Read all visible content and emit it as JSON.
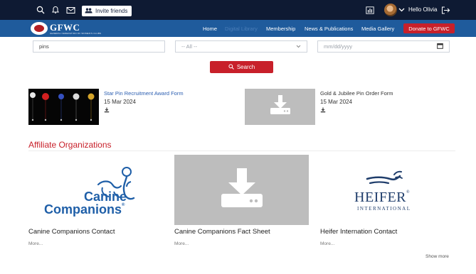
{
  "topbar": {
    "invite_label": "Invite friends",
    "greeting": "Hello Olivia",
    "icons": [
      "search-icon",
      "bell-icon",
      "mail-icon",
      "users-icon",
      "chart-icon",
      "chevron-down-icon",
      "logout-icon"
    ]
  },
  "navbar": {
    "logo_text": "GFWC",
    "logo_subtext": "GENERAL FEDERATION OF WOMEN'S CLUBS",
    "items": [
      {
        "label": "Home"
      },
      {
        "label": "Digital Library"
      },
      {
        "label": "Membership"
      },
      {
        "label": "News & Publications"
      },
      {
        "label": "Media Gallery"
      }
    ],
    "active": "Digital Library",
    "donate_label": "Donate to GFWC"
  },
  "search": {
    "query": "pins",
    "category": "-- All --",
    "date_placeholder": "mm/dd/yyyy",
    "button_label": "Search"
  },
  "documents": [
    {
      "title": "Star Pin Recruitment Award Form",
      "date": "15 Mar 2024"
    },
    {
      "title": "Gold & Jubilee Pin Order Form",
      "date": "15 Mar 2024"
    }
  ],
  "affiliates": {
    "title": "Affiliate Organizations",
    "cards": [
      {
        "title": "Canine Companions Contact",
        "more": "More...",
        "logo_line1": "Canine",
        "logo_line2": "Companions",
        "logo_mark": "®"
      },
      {
        "title": "Canine Companions Fact Sheet",
        "more": "More..."
      },
      {
        "title": "Heifer Internation Contact",
        "more": "More...",
        "logo_line1": "HEIFER",
        "logo_line2": "INTERNATIONAL",
        "logo_mark": "®"
      }
    ],
    "show_more": "Show more"
  },
  "colors": {
    "topbar_bg": "#0e1a33",
    "navbar_bg": "#1f5b9c",
    "accent_red": "#c8202a",
    "link_blue": "#2a5db0",
    "canine_blue": "#1f5fa8",
    "heifer_navy": "#1f3d6b"
  }
}
